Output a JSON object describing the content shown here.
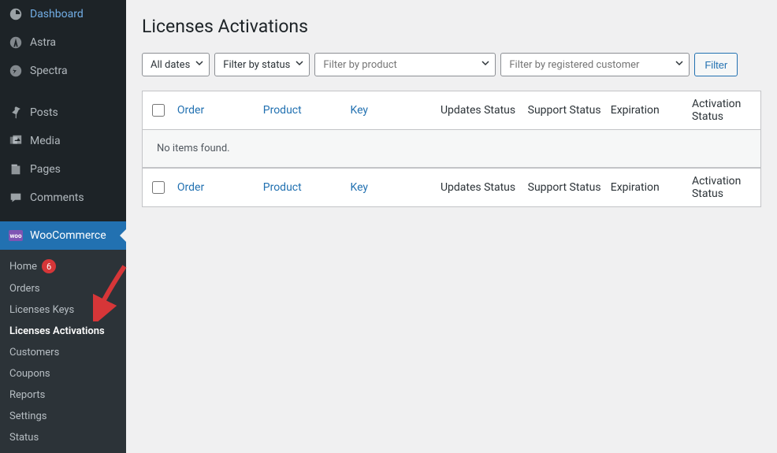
{
  "sidebar": {
    "items": [
      {
        "label": "Dashboard",
        "icon": "dashboard-icon"
      },
      {
        "label": "Astra",
        "icon": "astra-icon"
      },
      {
        "label": "Spectra",
        "icon": "spectra-icon"
      },
      {
        "label": "Posts",
        "icon": "pin-icon"
      },
      {
        "label": "Media",
        "icon": "media-icon"
      },
      {
        "label": "Pages",
        "icon": "pages-icon"
      },
      {
        "label": "Comments",
        "icon": "comments-icon"
      },
      {
        "label": "WooCommerce",
        "icon": "woo-icon"
      }
    ],
    "submenu": [
      {
        "label": "Home",
        "badge": "6"
      },
      {
        "label": "Orders"
      },
      {
        "label": "Licenses Keys"
      },
      {
        "label": "Licenses Activations",
        "active": true
      },
      {
        "label": "Customers"
      },
      {
        "label": "Coupons"
      },
      {
        "label": "Reports"
      },
      {
        "label": "Settings"
      },
      {
        "label": "Status"
      }
    ]
  },
  "page": {
    "title": "Licenses Activations"
  },
  "filters": {
    "dates": "All dates",
    "status": "Filter by status",
    "product_placeholder": "Filter by product",
    "customer_placeholder": "Filter by registered customer",
    "button": "Filter"
  },
  "table": {
    "columns": {
      "order": "Order",
      "product": "Product",
      "key": "Key",
      "updates": "Updates Status",
      "support": "Support Status",
      "expiration": "Expiration",
      "activation": "Activation Status"
    },
    "empty": "No items found."
  }
}
